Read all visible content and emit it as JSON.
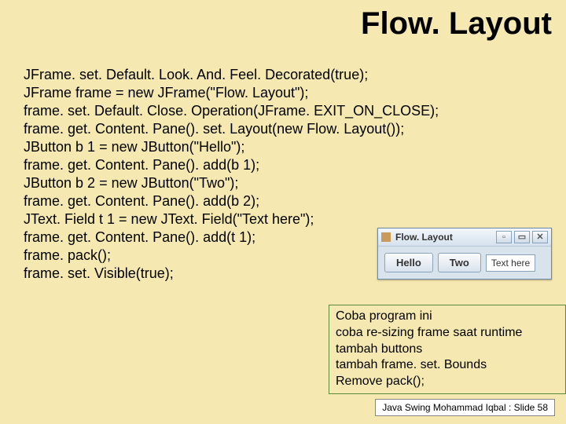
{
  "title": "Flow. Layout",
  "code_lines": [
    "JFrame. set. Default. Look. And. Feel. Decorated(true);",
    "JFrame frame = new JFrame(\"Flow. Layout\");",
    "frame. set. Default. Close. Operation(JFrame. EXIT_ON_CLOSE);",
    "frame. get. Content. Pane(). set. Layout(new Flow. Layout());",
    "JButton b 1 = new JButton(\"Hello\");",
    "frame. get. Content. Pane(). add(b 1);",
    "JButton b 2 = new JButton(\"Two\");",
    "frame. get. Content. Pane(). add(b 2);",
    "JText. Field t 1 = new JText. Field(\"Text here\");",
    "frame. get. Content. Pane(). add(t 1);",
    "frame. pack();",
    "frame. set. Visible(true);"
  ],
  "window": {
    "title": "Flow. Layout",
    "buttons": [
      "Hello",
      "Two"
    ],
    "textfield": "Text here",
    "title_btn_glyphs": [
      "▫",
      "▭",
      "✕"
    ]
  },
  "notes": [
    "Coba program ini",
    "coba re-sizing frame saat runtime",
    "tambah buttons",
    "tambah frame. set. Bounds",
    "Remove pack();"
  ],
  "footer": "Java Swing Mohammad Iqbal : Slide 58"
}
